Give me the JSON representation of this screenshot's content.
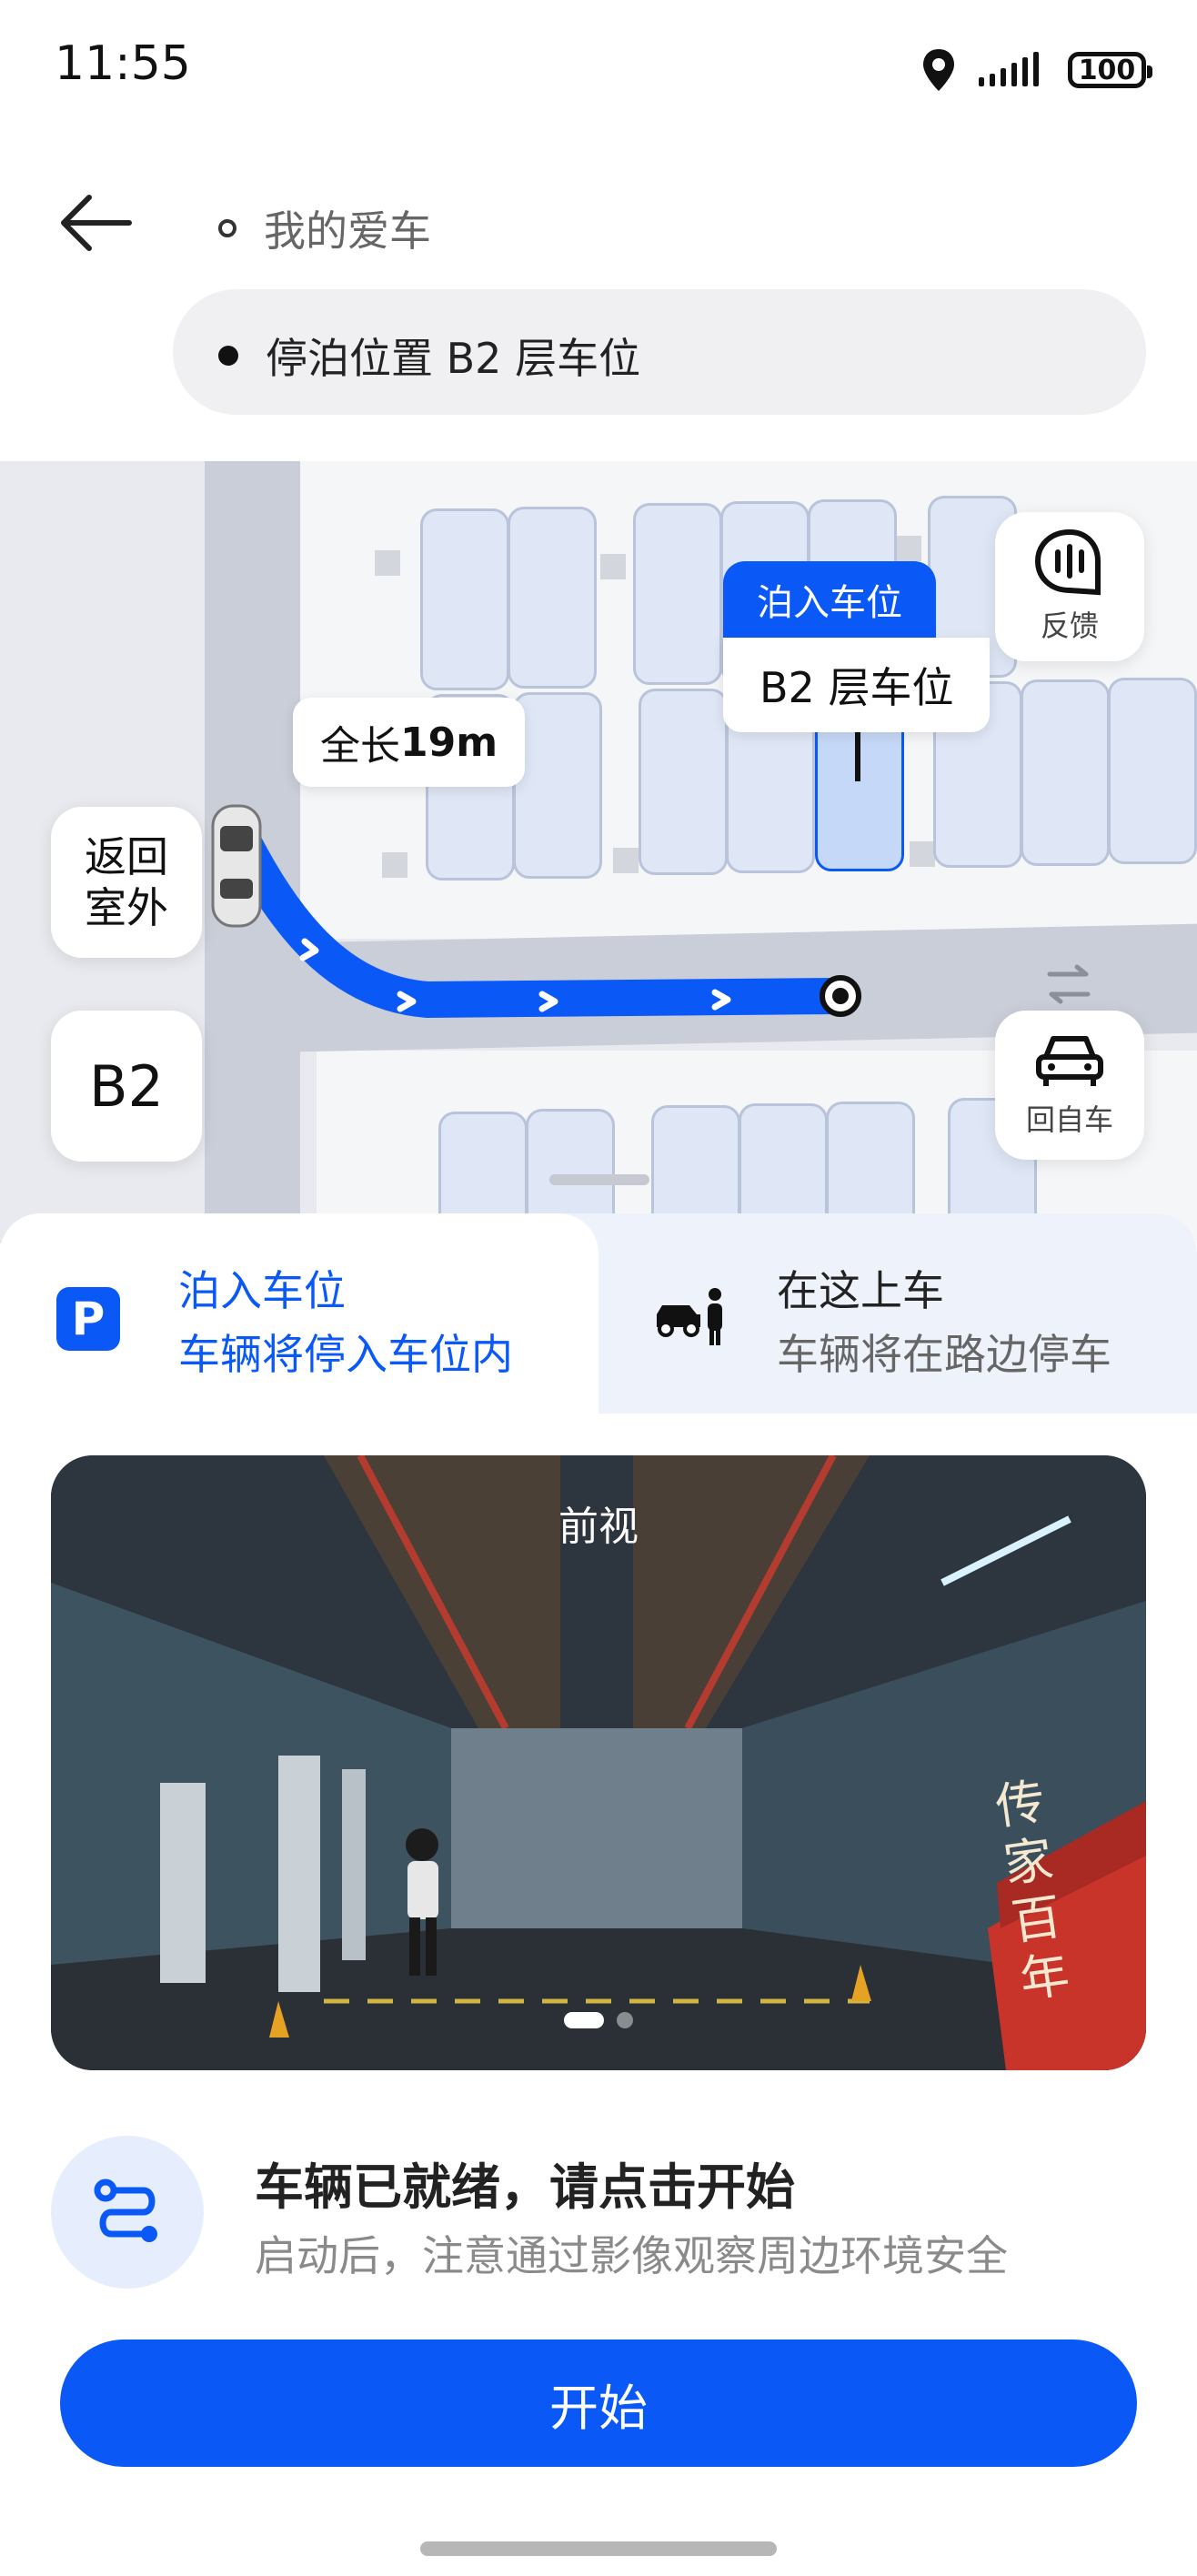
{
  "status_bar": {
    "time": "11:55",
    "battery": "100"
  },
  "header": {
    "from_label": "我的爱车",
    "to_label": "停泊位置 B2 层车位"
  },
  "map": {
    "distance_prefix": "全长 ",
    "distance_value": "19m",
    "target_tag": "泊入车位",
    "target_label": "B2 层车位",
    "feedback_label": "反馈",
    "return_outdoor_label": "返回室外",
    "floor_label": "B2",
    "back_to_car_label": "回自车"
  },
  "modes": [
    {
      "title": "泊入车位",
      "subtitle": "车辆将停入车位内",
      "active": true
    },
    {
      "title": "在这上车",
      "subtitle": "车辆将在路边停车",
      "active": false
    }
  ],
  "camera": {
    "label": "前视",
    "page_count": 2,
    "current_page": 1,
    "poster_text": "传家百年"
  },
  "ready": {
    "title": "车辆已就绪，请点击开始",
    "subtitle": "启动后，注意通过影像观察周边环境安全"
  },
  "start_button": "开始",
  "colors": {
    "accent": "#0a59f7",
    "route": "#0a59f7"
  }
}
